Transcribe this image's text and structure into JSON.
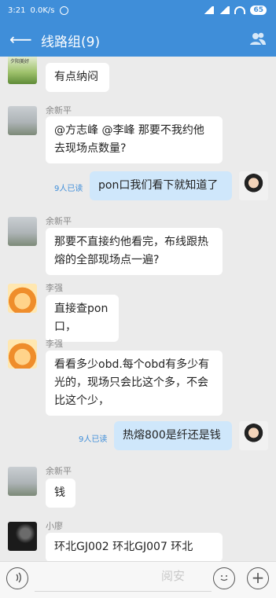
{
  "status": {
    "time": "3:21",
    "speed": "0.0K/s",
    "battery": "65"
  },
  "header": {
    "title": "线路组(9)"
  },
  "messages": [
    {
      "sender": "",
      "text": "有点纳闷"
    },
    {
      "sender": "余新平",
      "text": "@方志峰 @李峰 那要不我约他去现场点数量?"
    },
    {
      "sender": "me",
      "text": "pon口我们看下就知道了",
      "read": "9人已读"
    },
    {
      "sender": "余新平",
      "text": "那要不直接约他看完，布线跟热熔的全部现场点一遍?"
    },
    {
      "sender": "李强",
      "text": "直接查pon口，"
    },
    {
      "sender": "李强",
      "text": "看看多少obd.每个obd有多少有光的，现场只会比这个多，不会比这个少，"
    },
    {
      "sender": "me",
      "text": "热熔800是纤还是钱",
      "read": "9人已读"
    },
    {
      "sender": "余新平",
      "text": "钱"
    },
    {
      "sender": "小廖",
      "text": "环北GJ002 环北GJ007 环北"
    }
  ],
  "avatar_text": "夕阳美好",
  "input": {
    "voice_icon": "voice-icon",
    "emoji_icon": "emoji-icon",
    "plus_label": "+"
  },
  "watermark": "阅安"
}
